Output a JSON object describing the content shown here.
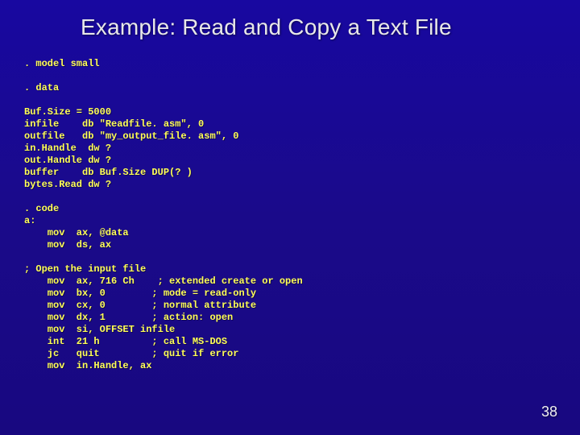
{
  "slide": {
    "title": "Example: Read and Copy a Text File",
    "code": ". model small\n\n. data\n\nBuf.Size = 5000\ninfile    db \"Readfile. asm\", 0\noutfile   db \"my_output_file. asm\", 0\nin.Handle  dw ?\nout.Handle dw ?\nbuffer    db Buf.Size DUP(? )\nbytes.Read dw ?\n\n. code\na:\n    mov  ax, @data\n    mov  ds, ax\n\n; Open the input file\n    mov  ax, 716 Ch    ; extended create or open\n    mov  bx, 0        ; mode = read-only\n    mov  cx, 0        ; normal attribute\n    mov  dx, 1        ; action: open\n    mov  si, OFFSET infile\n    int  21 h         ; call MS-DOS\n    jc   quit         ; quit if error\n    mov  in.Handle, ax",
    "page_number": "38"
  }
}
